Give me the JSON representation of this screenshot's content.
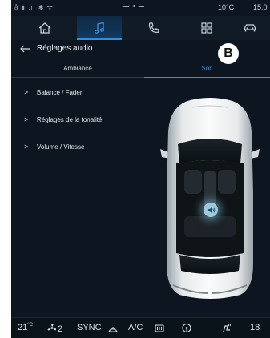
{
  "status_bar": {
    "icons": "å ▮ .ıl ✱ ᯤ",
    "temperature": "10°C",
    "time": "15:0"
  },
  "nav": {
    "items": [
      {
        "icon": "home-icon"
      },
      {
        "icon": "music-icon",
        "active": true
      },
      {
        "icon": "phone-icon"
      },
      {
        "icon": "apps-icon"
      },
      {
        "icon": "car-icon"
      }
    ]
  },
  "header": {
    "title": "Réglages audio"
  },
  "tabs": {
    "ambiance": "Ambiance",
    "son": "Son",
    "active": "son"
  },
  "callout": "B",
  "menu": {
    "items": [
      {
        "label": "Balance / Fader"
      },
      {
        "label": "Réglages de la tonalité"
      },
      {
        "label": "Volume / Vitesse"
      }
    ]
  },
  "climate": {
    "left_temp": "21",
    "left_temp_unit": "°C",
    "fan_speed": "2",
    "sync": "SYNC",
    "ac": "A/C",
    "right_temp": "18"
  },
  "colors": {
    "background": "#0d1620",
    "accent": "#2f8fe0",
    "speaker_glow": "#9ecadb"
  }
}
